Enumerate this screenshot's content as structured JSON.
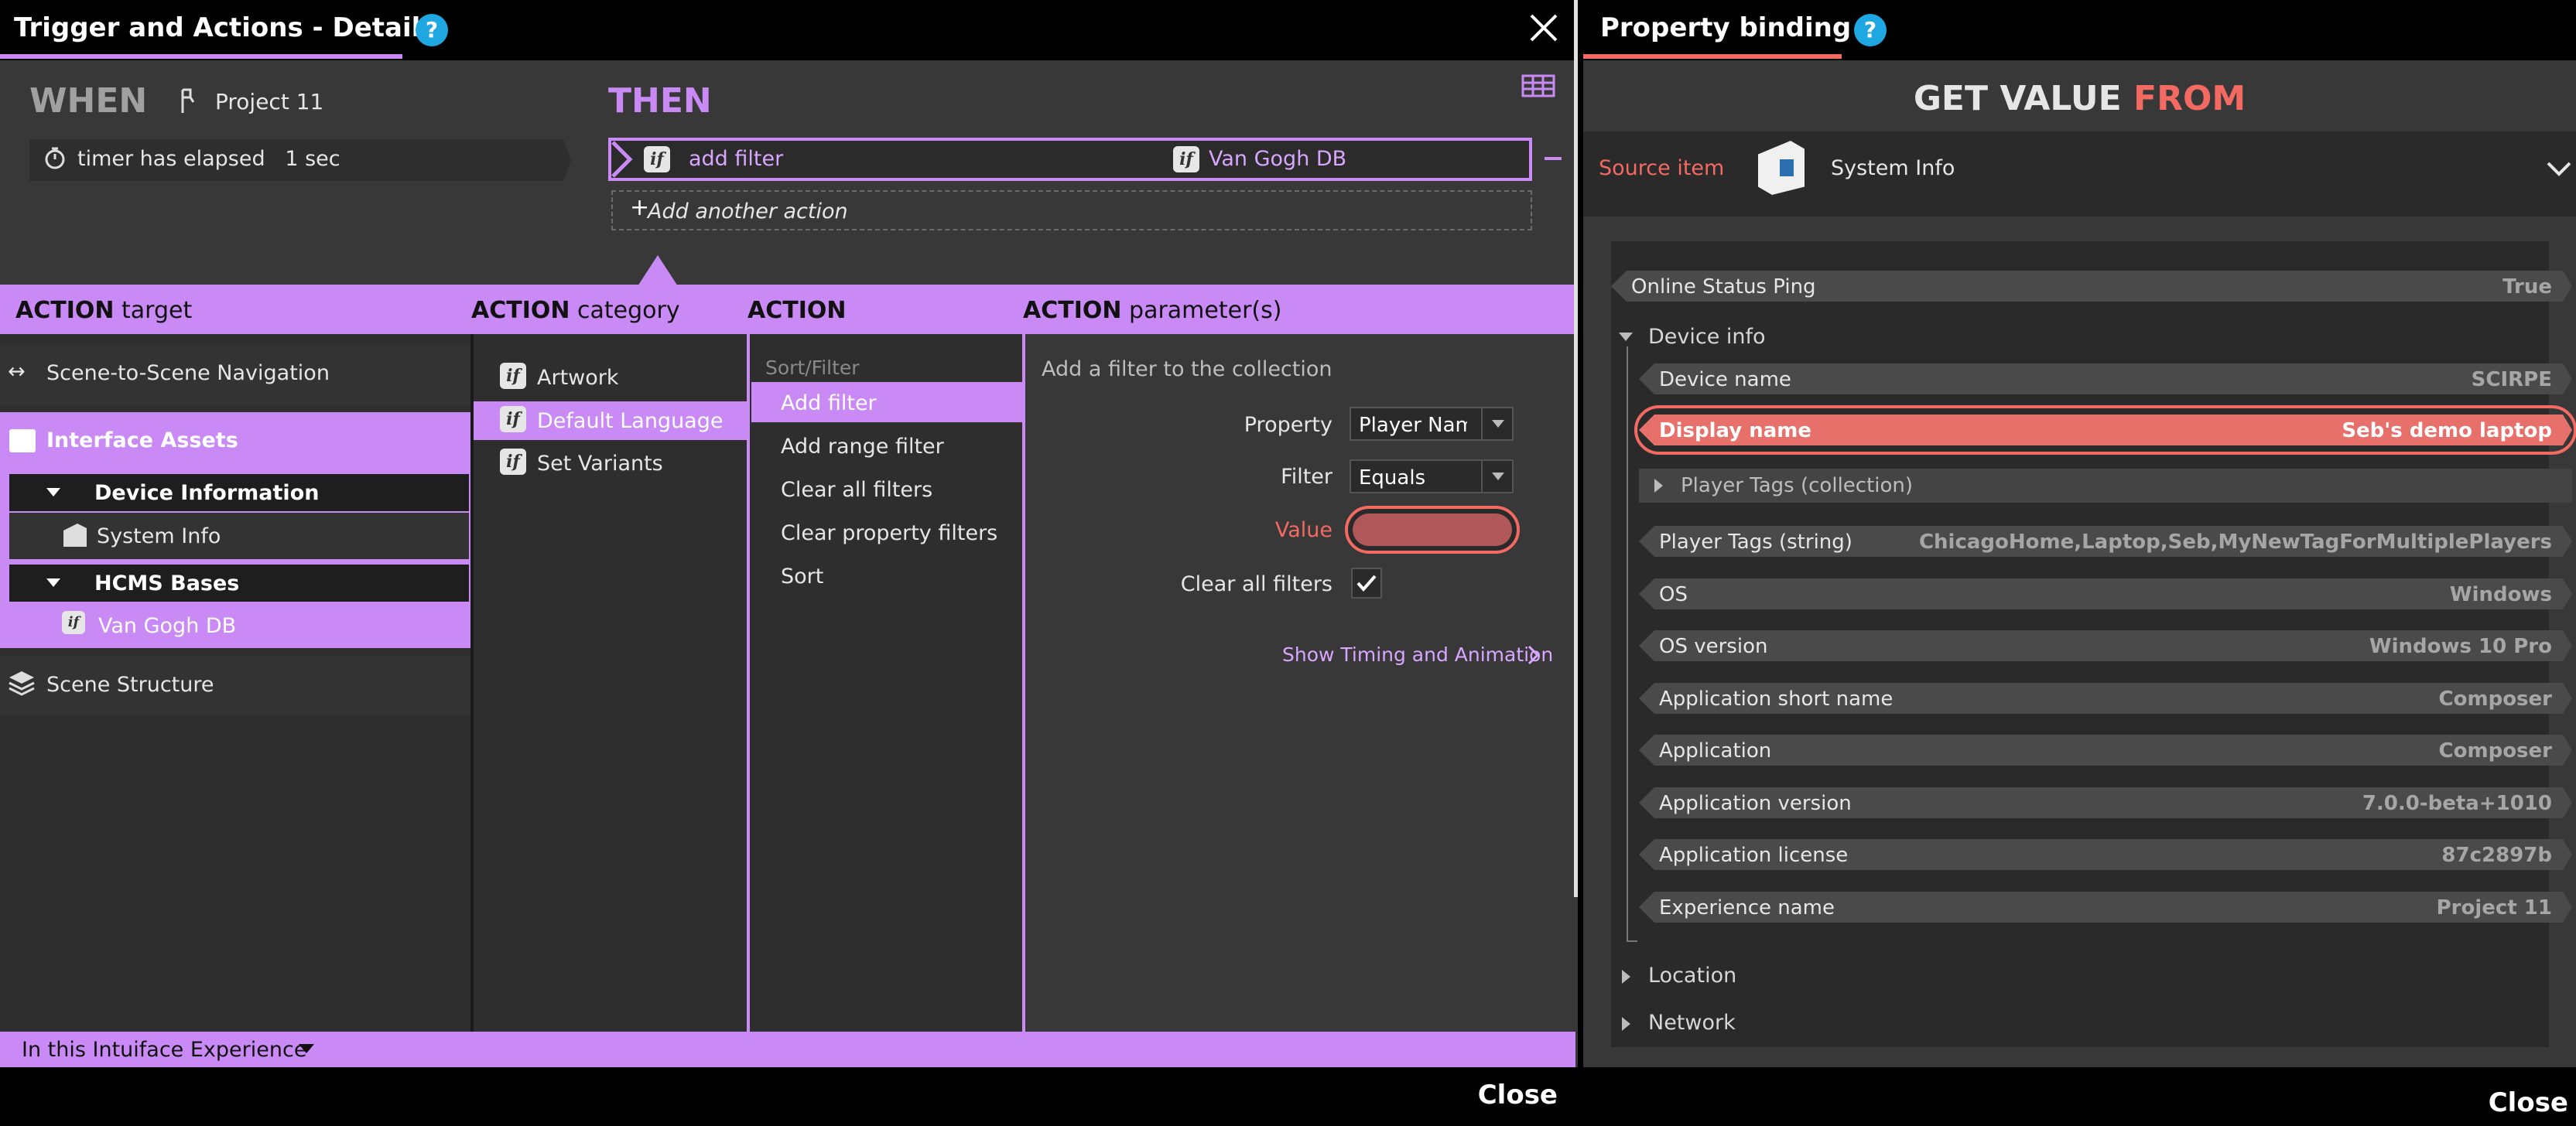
{
  "left_dialog": {
    "title": "Trigger and Actions - Details",
    "help": "?",
    "when_label": "WHEN",
    "project_name": "Project 11",
    "trigger_text": "timer has elapsed",
    "trigger_value": "1 sec",
    "then_label": "THEN",
    "action": {
      "name": "add filter",
      "target": "Van Gogh DB"
    },
    "add_action_label": "Add another action",
    "columns": {
      "target": {
        "bold": "ACTION",
        "rest": "target"
      },
      "category": {
        "bold": "ACTION",
        "rest": "category"
      },
      "action": {
        "bold": "ACTION",
        "rest": ""
      },
      "params": {
        "bold": "ACTION",
        "rest": "parameter(s)"
      }
    },
    "targets": {
      "scene_nav": "Scene-to-Scene Navigation",
      "interface_assets": "Interface Assets",
      "device_information": "Device Information",
      "system_info": "System Info",
      "hcms_bases": "HCMS Bases",
      "van_gogh_db": "Van Gogh DB",
      "scene_structure": "Scene Structure"
    },
    "categories": [
      "Artwork",
      "Default Language",
      "Set Variants"
    ],
    "actions": {
      "group": "Sort/Filter",
      "items": [
        "Add filter",
        "Add range filter",
        "Clear all filters",
        "Clear property filters",
        "Sort"
      ]
    },
    "params": {
      "description": "Add a filter to the collection",
      "property_label": "Property",
      "property_value": "Player Name",
      "filter_label": "Filter",
      "filter_value": "Equals",
      "value_label": "Value",
      "clear_all_label": "Clear all filters",
      "timing_link": "Show Timing and Animation"
    },
    "scope_label": "In this Intuiface Experience",
    "close": "Close"
  },
  "right_dialog": {
    "title": "Property binding",
    "help": "?",
    "get_value": "GET VALUE",
    "from": "FROM",
    "source_label": "Source item",
    "source_value": "System Info",
    "online_status": {
      "key": "Online Status Ping",
      "value": "True"
    },
    "device_info_label": "Device info",
    "rows": [
      {
        "key": "Device name",
        "value": "SCIRPE"
      },
      {
        "key": "Display name",
        "value": "Seb's demo laptop"
      },
      {
        "key": "Player Tags (collection)",
        "value": ""
      },
      {
        "key": "Player Tags (string)",
        "value": "ChicagoHome,Laptop,Seb,MyNewTagForMultiplePlayers"
      },
      {
        "key": "OS",
        "value": "Windows"
      },
      {
        "key": "OS version",
        "value": "Windows 10 Pro"
      },
      {
        "key": "Application short name",
        "value": "Composer"
      },
      {
        "key": "Application",
        "value": "Composer"
      },
      {
        "key": "Application version",
        "value": "7.0.0-beta+1010"
      },
      {
        "key": "Application license",
        "value": "87c2897b"
      },
      {
        "key": "Experience name",
        "value": "Project 11"
      }
    ],
    "location_label": "Location",
    "network_label": "Network",
    "close": "Close"
  },
  "colors": {
    "accent_purple": "#c98af5",
    "accent_red": "#f26a62",
    "help_blue": "#1ea7e1",
    "panel_bg": "#383838"
  }
}
